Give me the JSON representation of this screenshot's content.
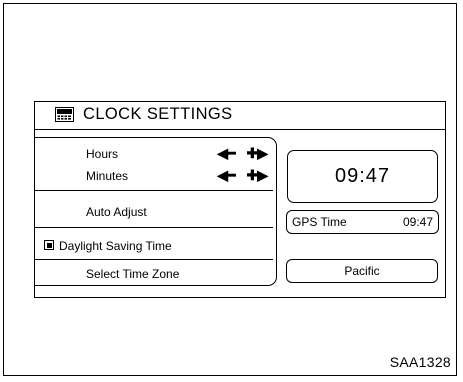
{
  "screen": {
    "title": "CLOCK SETTINGS",
    "title_icon": "clock-settings-icon"
  },
  "menu": {
    "hours_label": "Hours",
    "minutes_label": "Minutes",
    "auto_adjust_label": "Auto Adjust",
    "daylight_saving_label": "Daylight Saving Time",
    "daylight_saving_on": true,
    "select_time_zone_label": "Select Time Zone",
    "decrease_symbol": "◀━",
    "increase_symbol": "✚▶"
  },
  "display": {
    "time": "09:47",
    "gps_label": "GPS Time",
    "gps_time": "09:47",
    "time_zone": "Pacific"
  },
  "figure_code": "SAA1328"
}
